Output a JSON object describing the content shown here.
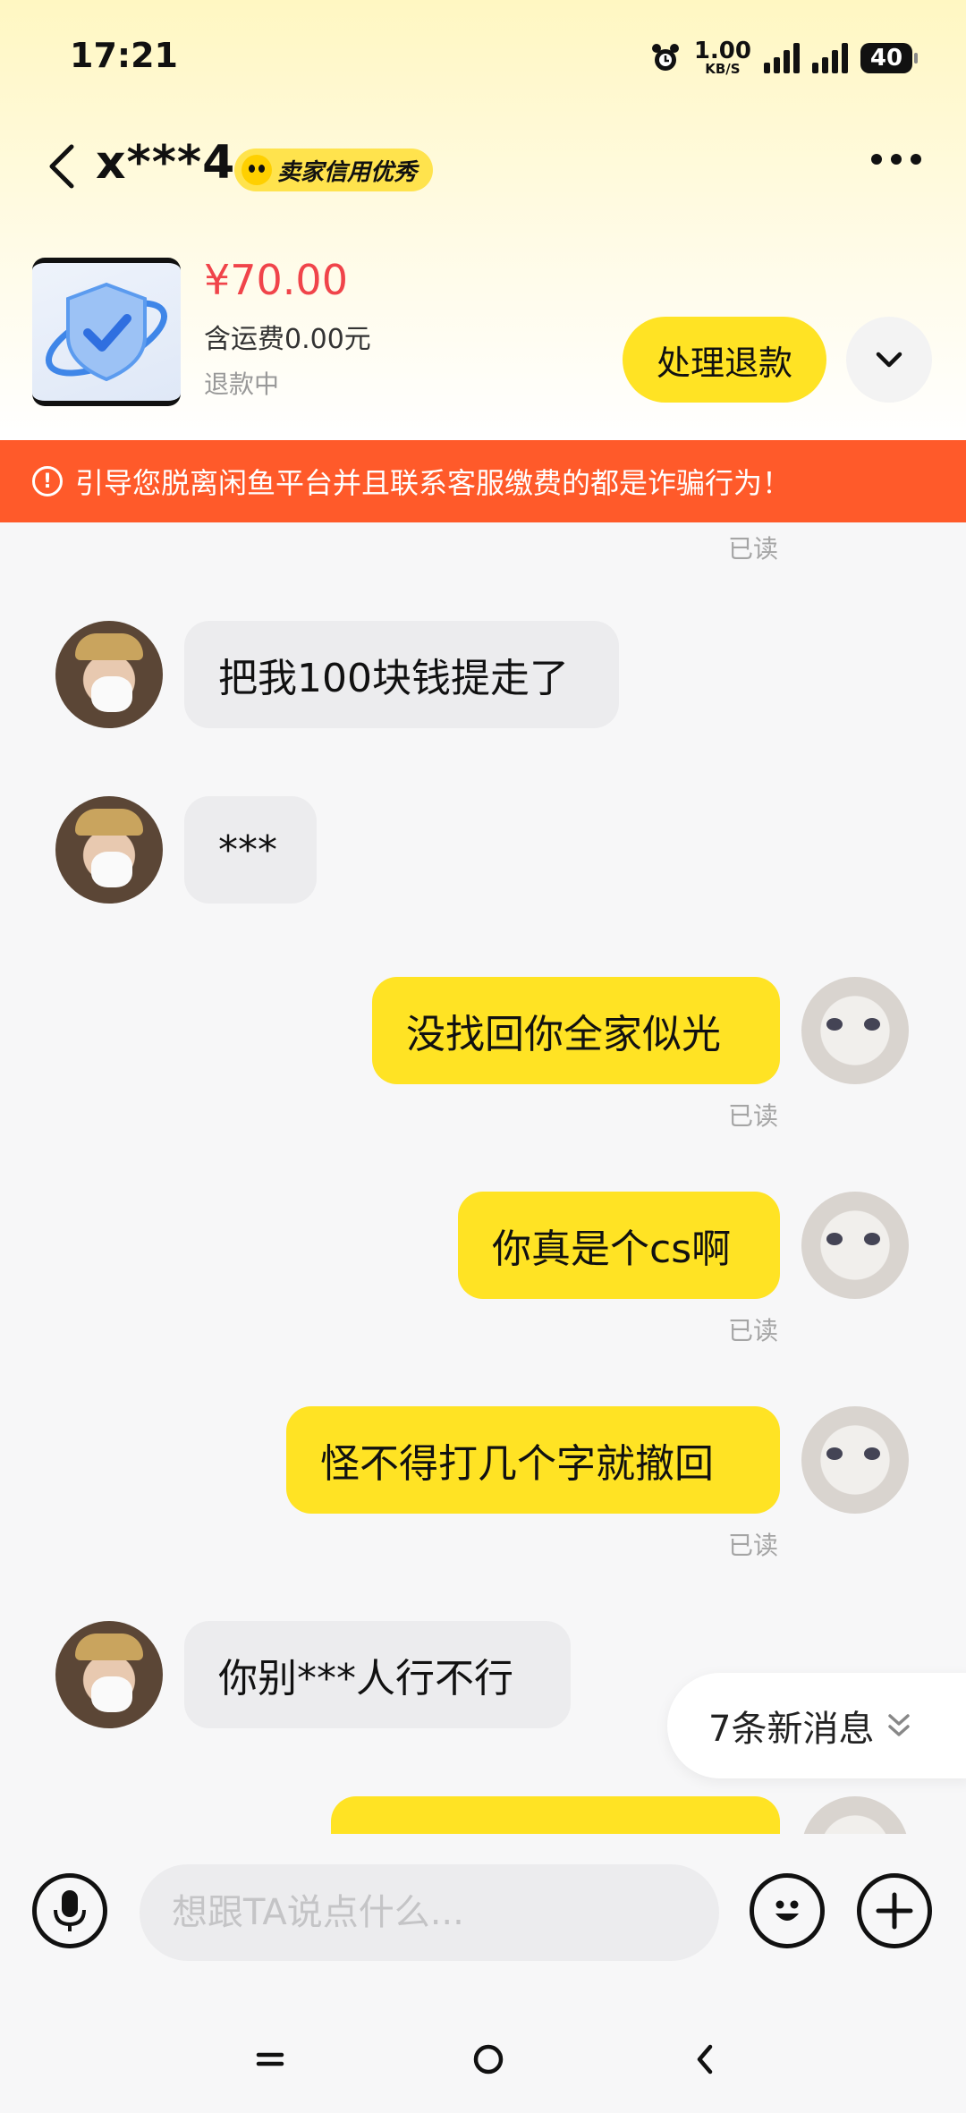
{
  "status_bar": {
    "time": "17:21",
    "net_speed": "1.00",
    "net_unit": "KB/S",
    "battery": "40"
  },
  "header": {
    "contact_name": "x***4",
    "credit_badge": "卖家信用优秀"
  },
  "product": {
    "price": "¥70.00",
    "shipping": "含运费0.00元",
    "status": "退款中",
    "action_label": "处理退款"
  },
  "warning": {
    "text": "引导您脱离闲鱼平台并且联系客服缴费的都是诈骗行为！"
  },
  "chat": {
    "read_label": "已读",
    "messages": [
      {
        "from": "peer",
        "text": "把我100块钱提走了"
      },
      {
        "from": "peer",
        "text": "***"
      },
      {
        "from": "self",
        "text": "没找回你全家似光",
        "read": "已读"
      },
      {
        "from": "self",
        "text": "你真是个cs啊",
        "read": "已读"
      },
      {
        "from": "self",
        "text": "怪不得打几个字就撤回",
        "read": "已读"
      },
      {
        "from": "peer",
        "text": "你别***人行不行"
      }
    ],
    "new_messages": "7条新消息"
  },
  "input": {
    "placeholder": "想跟TA说点什么..."
  },
  "colors": {
    "accent": "#ffe324",
    "warning": "#ff5a2a",
    "price": "#f0444a"
  }
}
